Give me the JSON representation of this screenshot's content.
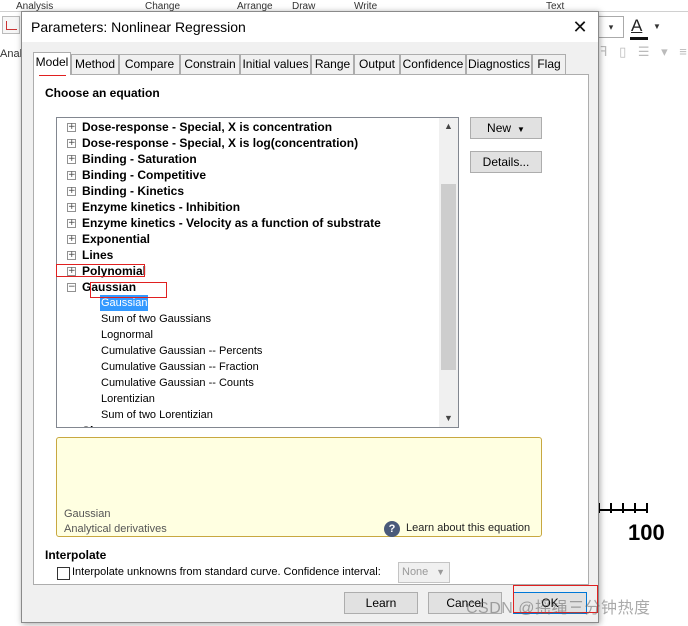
{
  "background": {
    "menu": [
      "Analysis",
      "Change",
      "Arrange",
      "Draw",
      "Write",
      "Text"
    ],
    "left_label": "Analy",
    "font_color_letter": "A",
    "chart_axis_value": "100",
    "watermark": "CSDN @摇绳三分钟热度"
  },
  "dialog": {
    "title": "Parameters: Nonlinear Regression",
    "close_glyph": "✕",
    "tabs": [
      "Model",
      "Method",
      "Compare",
      "Constrain",
      "Initial values",
      "Range",
      "Output",
      "Confidence",
      "Diagnostics",
      "Flag"
    ],
    "active_tab": "Model",
    "choose_label": "Choose an equation",
    "tree": {
      "groups": [
        {
          "label": "Dose-response - Special, X is concentration",
          "expander": "+"
        },
        {
          "label": "Dose-response - Special, X is log(concentration)",
          "expander": "+"
        },
        {
          "label": "Binding - Saturation",
          "expander": "+"
        },
        {
          "label": "Binding - Competitive",
          "expander": "+"
        },
        {
          "label": "Binding - Kinetics",
          "expander": "+"
        },
        {
          "label": "Enzyme kinetics - Inhibition",
          "expander": "+"
        },
        {
          "label": "Enzyme kinetics - Velocity as a function of substrate",
          "expander": "+"
        },
        {
          "label": "Exponential",
          "expander": "+"
        },
        {
          "label": "Lines",
          "expander": "+"
        },
        {
          "label": "Polynomial",
          "expander": "+"
        },
        {
          "label": "Gaussian",
          "expander": "−"
        }
      ],
      "children": [
        "Gaussian",
        "Sum of two Gaussians",
        "Lognormal",
        "Cumulative Gaussian -- Percents",
        "Cumulative Gaussian -- Fraction",
        "Cumulative Gaussian -- Counts",
        "Lorentizian",
        "Sum of two Lorentizian"
      ],
      "selected_child": "Gaussian",
      "partial_next": "Si"
    },
    "new_button": "New",
    "details_button": "Details...",
    "description": {
      "name": "Gaussian",
      "subtitle": "Analytical derivatives",
      "help_glyph": "?",
      "learn_link": "Learn about this equation"
    },
    "interpolate": {
      "title": "Interpolate",
      "checkbox_label": "Interpolate unknowns from standard curve. Confidence interval:",
      "checked": false,
      "confidence_value": "None"
    },
    "buttons": {
      "learn": "Learn",
      "cancel": "Cancel",
      "ok": "OK"
    }
  }
}
